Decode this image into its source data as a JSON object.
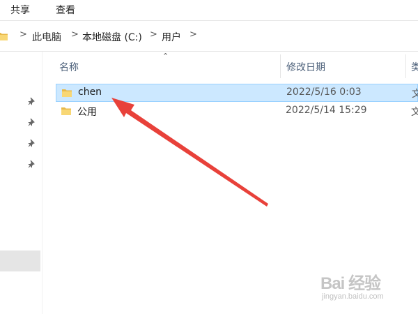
{
  "ribbon": {
    "tabs": [
      {
        "label": "共享"
      },
      {
        "label": "查看"
      }
    ]
  },
  "address_bar": {
    "crumbs": [
      {
        "label": "此电脑"
      },
      {
        "label": "本地磁盘 (C:)"
      },
      {
        "label": "用户"
      }
    ],
    "separator": ">"
  },
  "nav_pane": {
    "pins": [
      "pin-icon",
      "pin-icon",
      "pin-icon",
      "pin-icon"
    ]
  },
  "columns": {
    "name": "名称",
    "date_modified": "修改日期",
    "type": "类"
  },
  "files": [
    {
      "name": "chen",
      "date": "2022/5/16 0:03",
      "type": "文",
      "selected": true,
      "icon": "folder-icon"
    },
    {
      "name": "公用",
      "date": "2022/5/14 15:29",
      "type": "文",
      "selected": false,
      "icon": "folder-icon"
    }
  ],
  "annotation": {
    "color": "#e8413a"
  },
  "colors": {
    "selection_bg": "#cce8ff",
    "selection_border": "#99d1ff",
    "folder_yellow": "#f8d775"
  },
  "watermark": {
    "brand": "Bai 经验",
    "site": "jingyan.baidu.com"
  }
}
